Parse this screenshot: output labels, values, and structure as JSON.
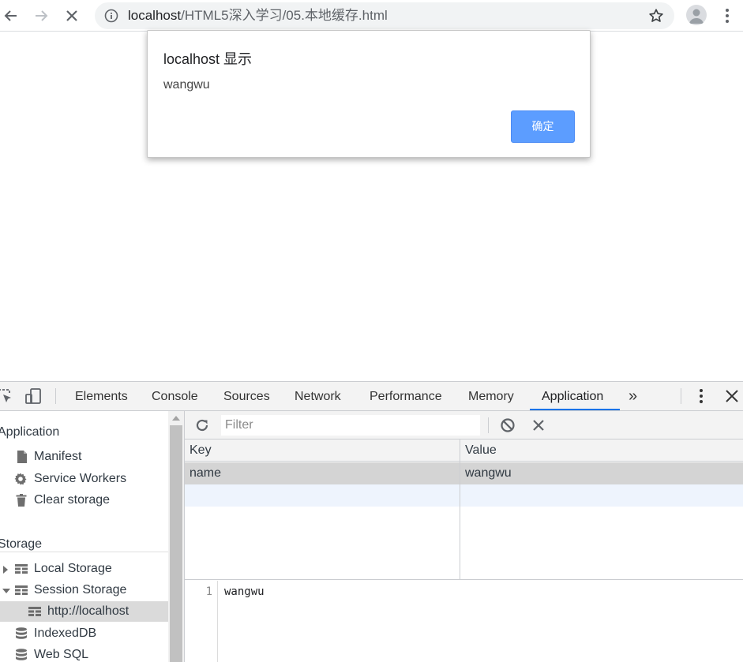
{
  "browser": {
    "url_host": "localhost",
    "url_path": "/HTML5深入学习/05.本地缓存.html"
  },
  "alert": {
    "title": "localhost 显示",
    "message": "wangwu",
    "ok_label": "确定"
  },
  "devtools": {
    "tabs": [
      "Elements",
      "Console",
      "Sources",
      "Network",
      "Performance",
      "Memory",
      "Application"
    ],
    "active_tab": "Application",
    "more_tabs_label": "»",
    "sidebar": {
      "application_header": "Application",
      "application_items": [
        "Manifest",
        "Service Workers",
        "Clear storage"
      ],
      "storage_header": "Storage",
      "storage_items": [
        {
          "label": "Local Storage",
          "state": "collapsed"
        },
        {
          "label": "Session Storage",
          "state": "expanded"
        },
        {
          "label": "http://localhost",
          "state": "selected"
        },
        {
          "label": "IndexedDB"
        },
        {
          "label": "Web SQL"
        }
      ]
    },
    "storage_panel": {
      "filter_placeholder": "Filter",
      "columns": [
        "Key",
        "Value"
      ],
      "rows": [
        {
          "key": "name",
          "value": "wangwu"
        }
      ],
      "preview": {
        "line_number": "1",
        "text": "wangwu"
      }
    },
    "accent_color": "#1a73e8"
  }
}
